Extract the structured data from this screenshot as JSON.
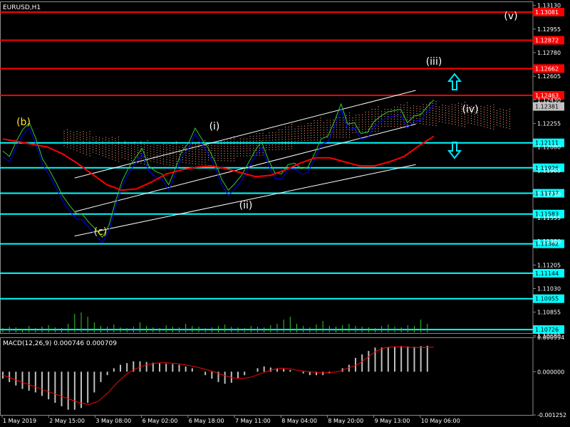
{
  "chart_data": {
    "type": "line",
    "title": "EURUSD,H1",
    "price_panel": {
      "ylim": [
        1.107,
        1.1316
      ],
      "axis_ticks": [
        "1.13130",
        "1.12955",
        "1.12780",
        "1.12605",
        "1.12430",
        "1.12255",
        "1.12080",
        "1.11905",
        "1.11730",
        "1.11555",
        "1.11380",
        "1.11205",
        "1.11030",
        "1.10855",
        "1.10680"
      ],
      "red_levels": [
        {
          "value": 1.13081,
          "label": "1.13081"
        },
        {
          "value": 1.12872,
          "label": "1.12872"
        },
        {
          "value": 1.12662,
          "label": "1.12662"
        },
        {
          "value": 1.12463,
          "label": "1.12463"
        }
      ],
      "cyan_levels": [
        {
          "value": 1.12111,
          "label": "1.12111"
        },
        {
          "value": 1.11926,
          "label": "1.11926"
        },
        {
          "value": 1.11737,
          "label": "1.11737"
        },
        {
          "value": 1.11583,
          "label": "1.11583"
        },
        {
          "value": 1.11362,
          "label": "1.11362"
        },
        {
          "value": 1.11144,
          "label": "1.11144"
        },
        {
          "value": 1.10955,
          "label": "1.10955"
        },
        {
          "value": 1.10726,
          "label": "1.10726"
        }
      ],
      "current_price": {
        "value": 1.12381,
        "label": "1.12381"
      },
      "price_series": [
        1.1205,
        1.1201,
        1.1212,
        1.1221,
        1.1226,
        1.1214,
        1.1199,
        1.1191,
        1.1182,
        1.1172,
        1.1165,
        1.1159,
        1.1158,
        1.1152,
        1.1147,
        1.1141,
        1.115,
        1.1168,
        1.1183,
        1.1193,
        1.12,
        1.1207,
        1.1194,
        1.119,
        1.1188,
        1.118,
        1.1192,
        1.1205,
        1.1211,
        1.1222,
        1.1214,
        1.1207,
        1.1197,
        1.1184,
        1.1176,
        1.1181,
        1.1187,
        1.1196,
        1.1205,
        1.1212,
        1.1199,
        1.1189,
        1.1188,
        1.1195,
        1.1196,
        1.1192,
        1.1193,
        1.1203,
        1.1214,
        1.1216,
        1.1227,
        1.124,
        1.1225,
        1.1226,
        1.1218,
        1.1219,
        1.1227,
        1.1231,
        1.1234,
        1.1235,
        1.1236,
        1.1226,
        1.1231,
        1.1232,
        1.1238,
        1.1243
      ],
      "ma_red": [
        1.1214,
        1.1212,
        1.121,
        1.1208,
        1.1203,
        1.1196,
        1.1188,
        1.118,
        1.1176,
        1.1177,
        1.1182,
        1.1188,
        1.1191,
        1.1193,
        1.1194,
        1.1192,
        1.1189,
        1.1186,
        1.1187,
        1.1191,
        1.1196,
        1.12,
        1.12,
        1.1197,
        1.1194,
        1.1194,
        1.1197,
        1.1201,
        1.1209,
        1.1216
      ],
      "channel_lines": [
        {
          "x1": 0.14,
          "y1": 1.1185,
          "x2": 0.78,
          "y2": 1.125
        },
        {
          "x1": 0.14,
          "y1": 1.116,
          "x2": 0.78,
          "y2": 1.1225
        },
        {
          "x1": 0.14,
          "y1": 1.1142,
          "x2": 0.78,
          "y2": 1.1195
        }
      ],
      "wave_labels": [
        {
          "text": "(b)",
          "color": "#ffe12b"
        },
        {
          "text": "(c)",
          "color": "#ffe12b"
        },
        {
          "text": "(i)",
          "color": "#ffffff"
        },
        {
          "text": "(ii)",
          "color": "#ffffff"
        },
        {
          "text": "(iii)",
          "color": "#ffffff"
        },
        {
          "text": "(iv)",
          "color": "#ffffff"
        },
        {
          "text": "(v)",
          "color": "#ffffff"
        }
      ],
      "volume_bars": [
        6,
        8,
        7,
        5,
        9,
        6,
        8,
        10,
        7,
        6,
        12,
        26,
        28,
        22,
        14,
        9,
        8,
        11,
        7,
        6,
        8,
        14,
        9,
        7,
        6,
        10,
        8,
        7,
        12,
        9,
        8,
        6,
        7,
        9,
        11,
        8,
        7,
        6,
        9,
        8,
        7,
        10,
        12,
        18,
        22,
        12,
        9,
        7,
        11,
        16,
        9,
        8,
        10,
        12,
        9,
        8,
        7,
        6,
        9,
        11,
        8,
        7,
        10,
        9,
        18,
        12
      ]
    },
    "macd_panel": {
      "label": "MACD(12,26,9) 0.000746 0.000709",
      "ylim": [
        -0.00125,
        0.000994
      ],
      "axis_ticks": [
        "0.000994",
        "0.000000",
        "-0.001252"
      ],
      "histogram": [
        -0.0002,
        -0.0003,
        -0.0004,
        -0.0005,
        -0.00055,
        -0.0006,
        -0.0007,
        -0.0008,
        -0.0009,
        -0.001,
        -0.0011,
        -0.0011,
        -0.00105,
        -0.0009,
        -0.0006,
        -0.0003,
        -0.0001,
        0.0001,
        0.0002,
        0.00025,
        0.0003,
        0.0003,
        0.00028,
        0.00026,
        0.00024,
        0.00023,
        0.00022,
        0.0002,
        0.00015,
        0.0001,
        0.0,
        -0.0001,
        -0.0002,
        -0.0003,
        -0.00035,
        -0.00032,
        -0.0002,
        -0.0001,
        0.0,
        0.0001,
        0.00015,
        0.00012,
        0.0001,
        8e-05,
        5e-05,
        0.0,
        -5e-05,
        -0.0001,
        -0.0001,
        -0.0001,
        -5e-05,
        0.0,
        0.0001,
        0.0002,
        0.0004,
        0.0005,
        0.0006,
        0.0007,
        0.0007,
        0.0007,
        0.00072,
        0.00074,
        0.00073,
        0.00072,
        0.00074,
        0.00075
      ],
      "signal": [
        -0.0001,
        -0.0002,
        -0.0003,
        -0.0004,
        -0.0005,
        -0.0006,
        -0.0007,
        -0.0008,
        -0.0009,
        -0.00095,
        -0.00085,
        -0.0006,
        -0.0003,
        -5e-05,
        0.0001,
        0.0002,
        0.00025,
        0.00026,
        0.00024,
        0.0002,
        0.00015,
        8e-05,
        0.0,
        -0.0001,
        -0.00018,
        -0.0002,
        -0.00015,
        -5e-05,
        5e-05,
        0.0001,
        8e-05,
        3e-05,
        0.0,
        -3e-05,
        -3e-05,
        0.0,
        0.0001,
        0.0002,
        0.0004,
        0.0006,
        0.0007,
        0.00072,
        0.00071,
        0.0007,
        0.0007,
        0.00071
      ]
    },
    "x_ticks": [
      "1 May 2019",
      "2 May 15:00",
      "3 May 08:00",
      "6 May 02:00",
      "6 May 18:00",
      "7 May 11:00",
      "8 May 04:00",
      "8 May 20:00",
      "9 May 13:00",
      "10 May 06:00"
    ],
    "colors": {
      "price_line": "#32cd32",
      "red_level": "#ff0000",
      "cyan_level": "#00ffff",
      "ma": "#ff0000",
      "blue_line": "#0000ff",
      "cloud": "#ffa07a",
      "macd_hist": "#c0c0c0",
      "macd_signal": "#ff0000",
      "grid": "#3a3a3a",
      "arrows": "#00e5ff"
    }
  }
}
